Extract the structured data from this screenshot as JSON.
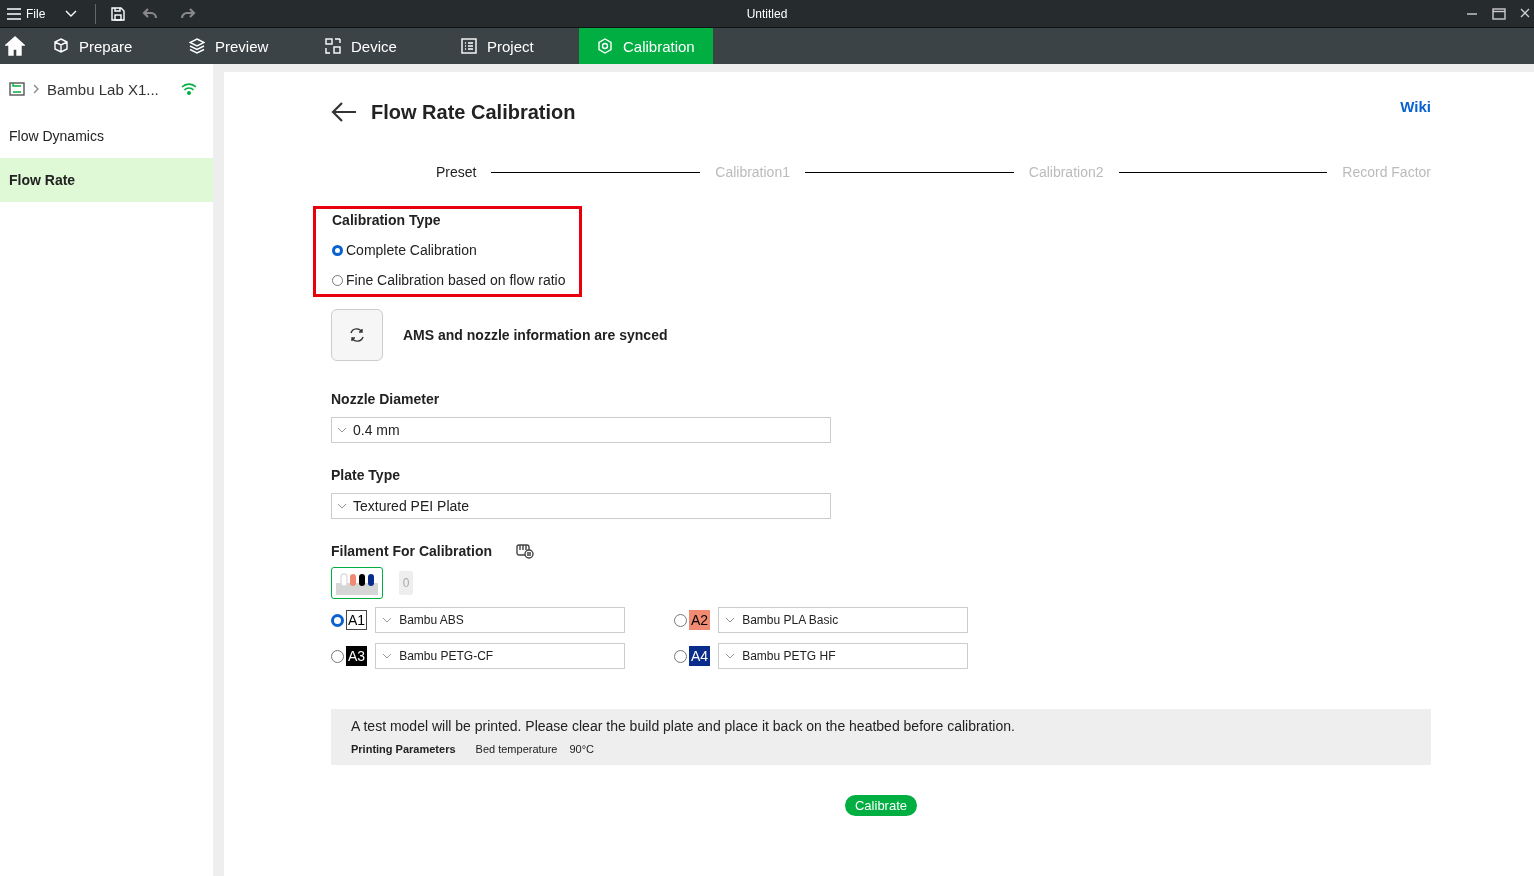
{
  "window": {
    "title": "Untitled",
    "menu": "File"
  },
  "tabs": [
    {
      "label": "Prepare",
      "selected": false
    },
    {
      "label": "Preview",
      "selected": false
    },
    {
      "label": "Device",
      "selected": false
    },
    {
      "label": "Project",
      "selected": false
    },
    {
      "label": "Calibration",
      "selected": true
    }
  ],
  "sidebar": {
    "device": "Bambu Lab X1...",
    "items": [
      {
        "label": "Flow Dynamics",
        "selected": false
      },
      {
        "label": "Flow Rate",
        "selected": true
      }
    ]
  },
  "page": {
    "title": "Flow Rate Calibration",
    "wiki": "Wiki",
    "steps": [
      {
        "label": "Preset",
        "active": true
      },
      {
        "label": "Calibration1",
        "active": false
      },
      {
        "label": "Calibration2",
        "active": false
      },
      {
        "label": "Record Factor",
        "active": false
      }
    ],
    "calibration_type": {
      "label": "Calibration Type",
      "highlighted": true,
      "options": [
        {
          "label": "Complete Calibration",
          "selected": true
        },
        {
          "label": "Fine Calibration based on flow ratio",
          "selected": false
        }
      ]
    },
    "sync_message": "AMS and nozzle information are synced",
    "nozzle": {
      "label": "Nozzle Diameter",
      "value": "0.4 mm"
    },
    "plate": {
      "label": "Plate Type",
      "value": "Textured PEI Plate"
    },
    "filament": {
      "label": "Filament For Calibration",
      "ams_units": [
        {
          "selected": true
        },
        {
          "label": "0",
          "selected": false
        }
      ],
      "slots": [
        {
          "slot": "A1",
          "color": "#ffffff",
          "selected": true,
          "value": "Bambu ABS"
        },
        {
          "slot": "A2",
          "color": "#f08a72",
          "selected": false,
          "value": "Bambu PLA Basic"
        },
        {
          "slot": "A3",
          "color": "#000000",
          "selected": false,
          "value": "Bambu PETG-CF"
        },
        {
          "slot": "A4",
          "color": "#0a2d8c",
          "selected": false,
          "value": "Bambu PETG HF"
        }
      ]
    },
    "notice": {
      "text": "A test model will be printed. Please clear the build plate and place it back on the heatbed before calibration.",
      "params_label": "Printing Parameters",
      "param_name": "Bed temperature",
      "param_value": "90°C"
    },
    "button": "Calibrate"
  }
}
